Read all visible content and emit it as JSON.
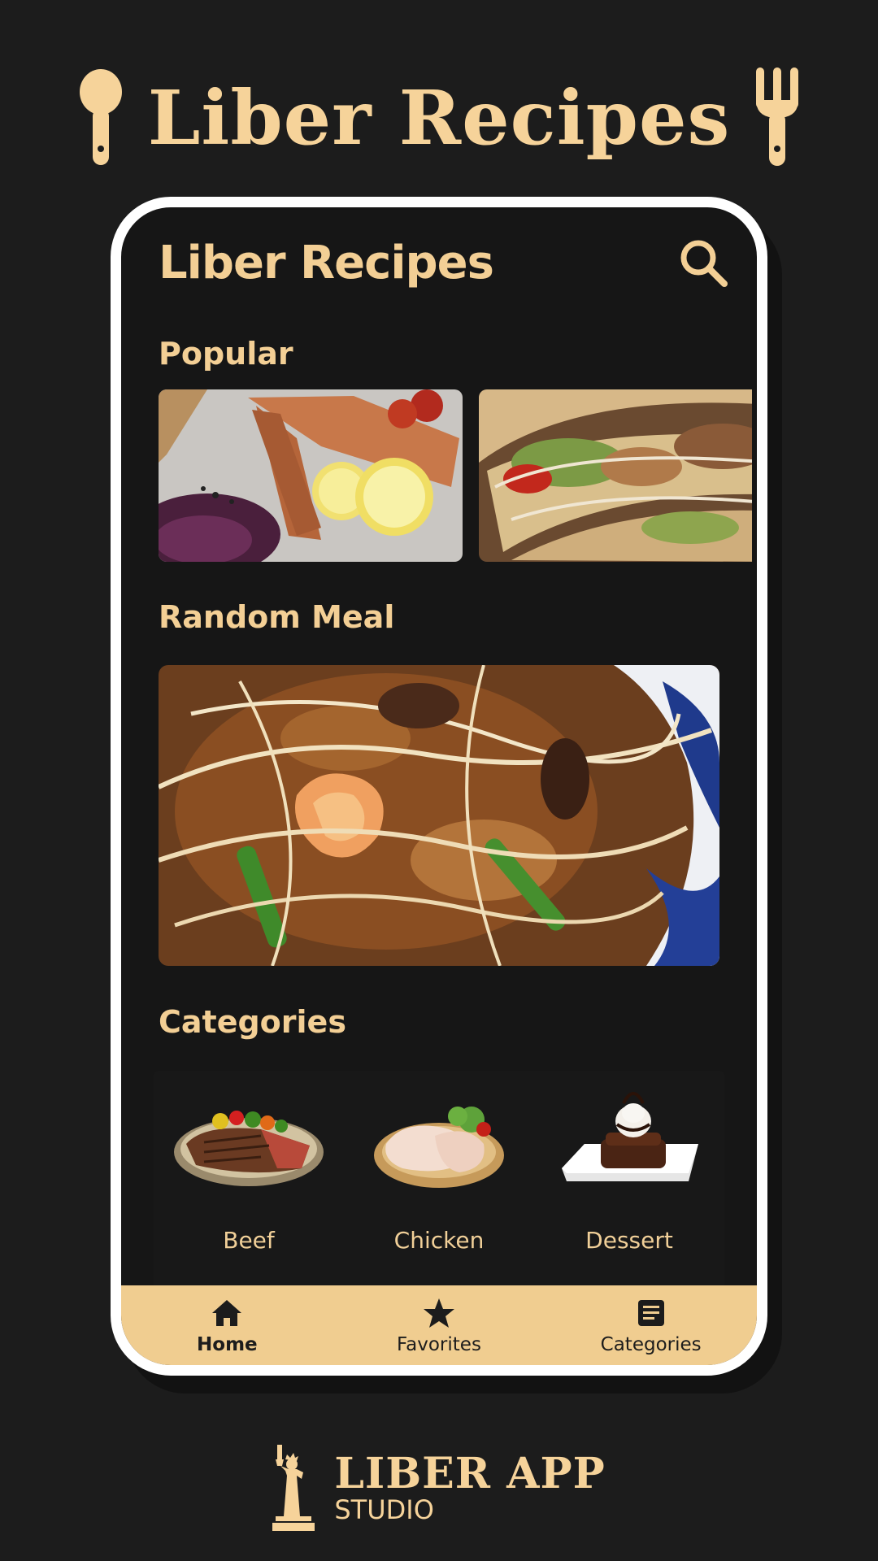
{
  "promo": {
    "title": "Liber Recipes"
  },
  "app": {
    "title": "Liber Recipes"
  },
  "sections": {
    "popular": "Popular",
    "random_meal": "Random Meal",
    "categories": "Categories"
  },
  "categories": [
    {
      "label": "Beef",
      "icon": "beef-plate-image"
    },
    {
      "label": "Chicken",
      "icon": "chicken-plate-image"
    },
    {
      "label": "Dessert",
      "icon": "dessert-plate-image"
    }
  ],
  "nav": [
    {
      "label": "Home",
      "icon": "home-icon",
      "active": true
    },
    {
      "label": "Favorites",
      "icon": "star-icon",
      "active": false
    },
    {
      "label": "Categories",
      "icon": "article-icon",
      "active": false
    }
  ],
  "studio": {
    "name": "LIBER APP",
    "sub": "STUDIO"
  },
  "colors": {
    "accent": "#f3cf95",
    "background": "#1c1c1c",
    "nav_bar": "#f0cd90"
  }
}
